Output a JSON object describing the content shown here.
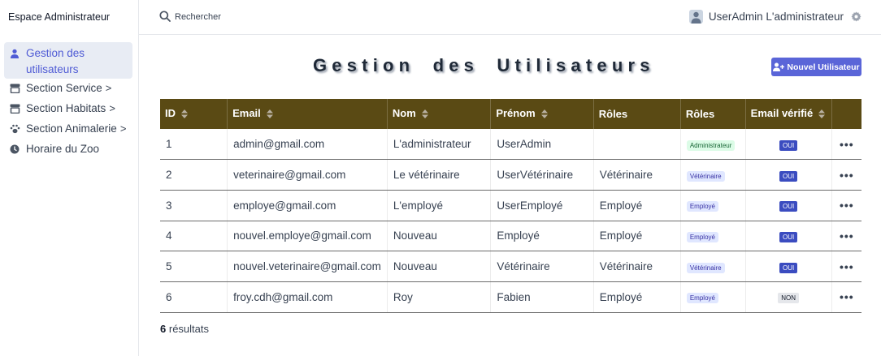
{
  "sidebar": {
    "brand": "Espace Administrateur",
    "items": [
      {
        "label_line1": "Gestion des",
        "label_line2": "utilisateurs",
        "icon": "user-icon",
        "active": true
      },
      {
        "label": "Section Service",
        "icon": "store-icon",
        "chevron": ">"
      },
      {
        "label": "Section Habitats",
        "icon": "store-icon",
        "chevron": ">"
      },
      {
        "label": "Section Animalerie",
        "icon": "paw-icon",
        "chevron": ">"
      },
      {
        "label": "Horaire du Zoo",
        "icon": "clock-icon"
      }
    ]
  },
  "topbar": {
    "search_placeholder": "Rechercher",
    "user_name": "UserAdmin L'administrateur"
  },
  "main": {
    "title": "Gestion des Utilisateurs",
    "new_button_label": "Nouvel Utilisateur",
    "columns": [
      "ID",
      "Email",
      "Nom",
      "Prénom",
      "Rôles",
      "Rôles",
      "Email vérifié",
      ""
    ],
    "rows": [
      {
        "id": "1",
        "email": "admin@gmail.com",
        "nom": "L'administrateur",
        "prenom": "UserAdmin",
        "role_text": "",
        "role_badge": "Administrateur",
        "verified": "OUI"
      },
      {
        "id": "2",
        "email": "veterinaire@gmail.com",
        "nom": "Le vétérinaire",
        "prenom": "UserVétérinaire",
        "role_text": "Vétérinaire",
        "role_badge": "Vétérinaire",
        "verified": "OUI"
      },
      {
        "id": "3",
        "email": "employe@gmail.com",
        "nom": "L'employé",
        "prenom": "UserEmployé",
        "role_text": "Employé",
        "role_badge": "Employé",
        "verified": "OUI"
      },
      {
        "id": "4",
        "email": "nouvel.employe@gmail.com",
        "nom": "Nouveau",
        "prenom": "Employé",
        "role_text": "Employé",
        "role_badge": "Employé",
        "verified": "OUI"
      },
      {
        "id": "5",
        "email": "nouvel.veterinaire@gmail.com",
        "nom": "Nouveau",
        "prenom": "Vétérinaire",
        "role_text": "Vétérinaire",
        "role_badge": "Vétérinaire",
        "verified": "OUI"
      },
      {
        "id": "6",
        "email": "froy.cdh@gmail.com",
        "nom": "Roy",
        "prenom": "Fabien",
        "role_text": "Employé",
        "role_badge": "Employé",
        "verified": "NON"
      }
    ],
    "actions_label": "•••",
    "results_count": "6",
    "results_label": "résultats"
  },
  "colors": {
    "accent": "#5a65d8",
    "table_header": "#5a4a14",
    "active_nav_bg": "#e8ecf4"
  }
}
